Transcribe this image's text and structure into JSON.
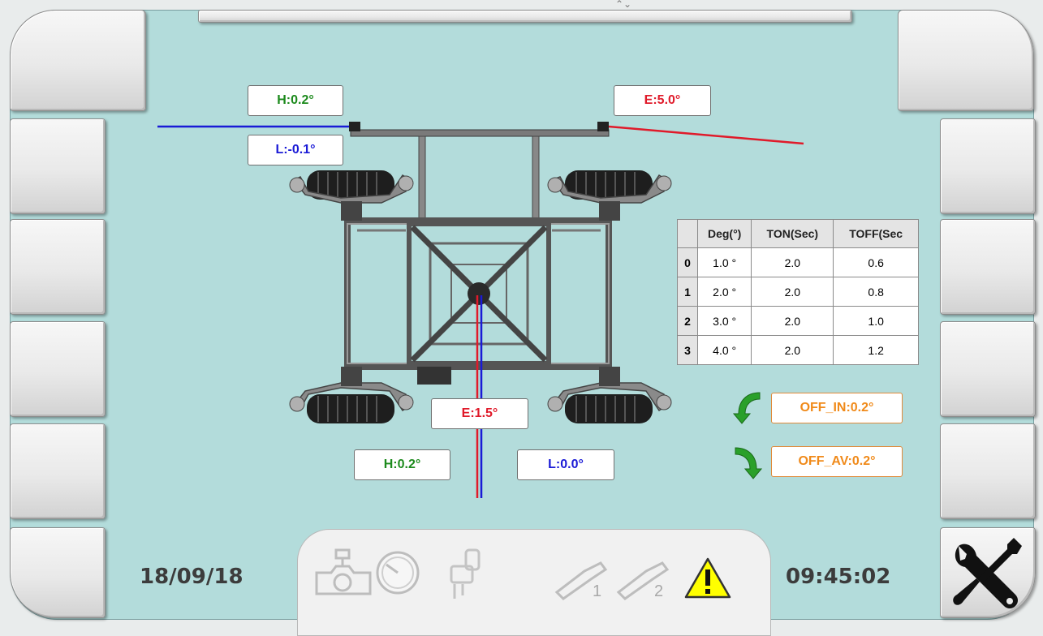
{
  "gauges": {
    "top_left_h": "H:0.2°",
    "top_left_l": "L:-0.1°",
    "top_right_e": "E:5.0°",
    "center_e": "E:1.5°",
    "bottom_h": "H:0.2°",
    "bottom_l": "L:0.0°"
  },
  "table": {
    "headers": [
      "",
      "Deg(°)",
      "TON(Sec)",
      "TOFF(Sec"
    ],
    "rows": [
      {
        "idx": "0",
        "deg": "1.0 °",
        "ton": "2.0",
        "toff": "0.6"
      },
      {
        "idx": "1",
        "deg": "2.0 °",
        "ton": "2.0",
        "toff": "0.8"
      },
      {
        "idx": "2",
        "deg": "3.0 °",
        "ton": "2.0",
        "toff": "1.0"
      },
      {
        "idx": "3",
        "deg": "4.0 °",
        "ton": "2.0",
        "toff": "1.2"
      }
    ]
  },
  "offsets": {
    "off_in": "OFF_IN:0.2°",
    "off_av": "OFF_AV:0.2°"
  },
  "status": {
    "date": "18/09/18",
    "time": "09:45:02",
    "sensor1_number": "1",
    "sensor2_number": "2"
  },
  "colors": {
    "background": "#b3dcdb",
    "high": "#1c8a1c",
    "low": "#1a1ad6",
    "error": "#e01a2a",
    "offset": "#f08a1a"
  },
  "icons": {
    "valve": "valve-icon",
    "pressure_gauge": "pressure-gauge-icon",
    "pump": "pump-icon",
    "sensor_1": "sensor-1-icon",
    "sensor_2": "sensor-2-icon",
    "warning": "warning-icon",
    "tools": "tools-icon",
    "rotate_in": "rotate-in-arrow-icon",
    "rotate_out": "rotate-out-arrow-icon"
  }
}
